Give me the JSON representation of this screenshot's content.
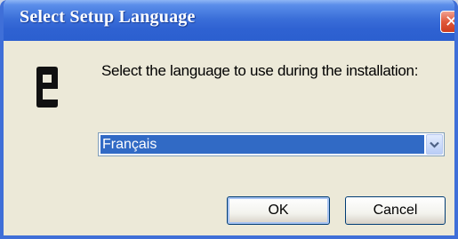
{
  "window": {
    "title": "Select Setup Language",
    "close_icon": "close-icon"
  },
  "prompt": "Select the language to use during the installation:",
  "language_select": {
    "selected": "Français",
    "icon": "chevron-down-icon"
  },
  "buttons": {
    "ok": "OK",
    "cancel": "Cancel"
  },
  "colors": {
    "title_bar": "#2f62d2",
    "close_button": "#e0583a",
    "selection": "#316ac5",
    "dialog_bg": "#ece9d8"
  }
}
